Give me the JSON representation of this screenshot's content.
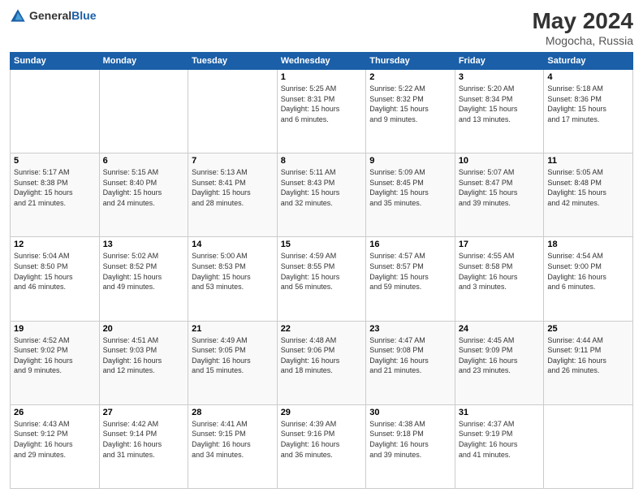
{
  "header": {
    "logo": {
      "general": "General",
      "blue": "Blue"
    },
    "title": "May 2024",
    "location": "Mogocha, Russia"
  },
  "days_of_week": [
    "Sunday",
    "Monday",
    "Tuesday",
    "Wednesday",
    "Thursday",
    "Friday",
    "Saturday"
  ],
  "weeks": [
    [
      {
        "day": "",
        "info": ""
      },
      {
        "day": "",
        "info": ""
      },
      {
        "day": "",
        "info": ""
      },
      {
        "day": "1",
        "info": "Sunrise: 5:25 AM\nSunset: 8:31 PM\nDaylight: 15 hours\nand 6 minutes."
      },
      {
        "day": "2",
        "info": "Sunrise: 5:22 AM\nSunset: 8:32 PM\nDaylight: 15 hours\nand 9 minutes."
      },
      {
        "day": "3",
        "info": "Sunrise: 5:20 AM\nSunset: 8:34 PM\nDaylight: 15 hours\nand 13 minutes."
      },
      {
        "day": "4",
        "info": "Sunrise: 5:18 AM\nSunset: 8:36 PM\nDaylight: 15 hours\nand 17 minutes."
      }
    ],
    [
      {
        "day": "5",
        "info": "Sunrise: 5:17 AM\nSunset: 8:38 PM\nDaylight: 15 hours\nand 21 minutes."
      },
      {
        "day": "6",
        "info": "Sunrise: 5:15 AM\nSunset: 8:40 PM\nDaylight: 15 hours\nand 24 minutes."
      },
      {
        "day": "7",
        "info": "Sunrise: 5:13 AM\nSunset: 8:41 PM\nDaylight: 15 hours\nand 28 minutes."
      },
      {
        "day": "8",
        "info": "Sunrise: 5:11 AM\nSunset: 8:43 PM\nDaylight: 15 hours\nand 32 minutes."
      },
      {
        "day": "9",
        "info": "Sunrise: 5:09 AM\nSunset: 8:45 PM\nDaylight: 15 hours\nand 35 minutes."
      },
      {
        "day": "10",
        "info": "Sunrise: 5:07 AM\nSunset: 8:47 PM\nDaylight: 15 hours\nand 39 minutes."
      },
      {
        "day": "11",
        "info": "Sunrise: 5:05 AM\nSunset: 8:48 PM\nDaylight: 15 hours\nand 42 minutes."
      }
    ],
    [
      {
        "day": "12",
        "info": "Sunrise: 5:04 AM\nSunset: 8:50 PM\nDaylight: 15 hours\nand 46 minutes."
      },
      {
        "day": "13",
        "info": "Sunrise: 5:02 AM\nSunset: 8:52 PM\nDaylight: 15 hours\nand 49 minutes."
      },
      {
        "day": "14",
        "info": "Sunrise: 5:00 AM\nSunset: 8:53 PM\nDaylight: 15 hours\nand 53 minutes."
      },
      {
        "day": "15",
        "info": "Sunrise: 4:59 AM\nSunset: 8:55 PM\nDaylight: 15 hours\nand 56 minutes."
      },
      {
        "day": "16",
        "info": "Sunrise: 4:57 AM\nSunset: 8:57 PM\nDaylight: 15 hours\nand 59 minutes."
      },
      {
        "day": "17",
        "info": "Sunrise: 4:55 AM\nSunset: 8:58 PM\nDaylight: 16 hours\nand 3 minutes."
      },
      {
        "day": "18",
        "info": "Sunrise: 4:54 AM\nSunset: 9:00 PM\nDaylight: 16 hours\nand 6 minutes."
      }
    ],
    [
      {
        "day": "19",
        "info": "Sunrise: 4:52 AM\nSunset: 9:02 PM\nDaylight: 16 hours\nand 9 minutes."
      },
      {
        "day": "20",
        "info": "Sunrise: 4:51 AM\nSunset: 9:03 PM\nDaylight: 16 hours\nand 12 minutes."
      },
      {
        "day": "21",
        "info": "Sunrise: 4:49 AM\nSunset: 9:05 PM\nDaylight: 16 hours\nand 15 minutes."
      },
      {
        "day": "22",
        "info": "Sunrise: 4:48 AM\nSunset: 9:06 PM\nDaylight: 16 hours\nand 18 minutes."
      },
      {
        "day": "23",
        "info": "Sunrise: 4:47 AM\nSunset: 9:08 PM\nDaylight: 16 hours\nand 21 minutes."
      },
      {
        "day": "24",
        "info": "Sunrise: 4:45 AM\nSunset: 9:09 PM\nDaylight: 16 hours\nand 23 minutes."
      },
      {
        "day": "25",
        "info": "Sunrise: 4:44 AM\nSunset: 9:11 PM\nDaylight: 16 hours\nand 26 minutes."
      }
    ],
    [
      {
        "day": "26",
        "info": "Sunrise: 4:43 AM\nSunset: 9:12 PM\nDaylight: 16 hours\nand 29 minutes."
      },
      {
        "day": "27",
        "info": "Sunrise: 4:42 AM\nSunset: 9:14 PM\nDaylight: 16 hours\nand 31 minutes."
      },
      {
        "day": "28",
        "info": "Sunrise: 4:41 AM\nSunset: 9:15 PM\nDaylight: 16 hours\nand 34 minutes."
      },
      {
        "day": "29",
        "info": "Sunrise: 4:39 AM\nSunset: 9:16 PM\nDaylight: 16 hours\nand 36 minutes."
      },
      {
        "day": "30",
        "info": "Sunrise: 4:38 AM\nSunset: 9:18 PM\nDaylight: 16 hours\nand 39 minutes."
      },
      {
        "day": "31",
        "info": "Sunrise: 4:37 AM\nSunset: 9:19 PM\nDaylight: 16 hours\nand 41 minutes."
      },
      {
        "day": "",
        "info": ""
      }
    ]
  ]
}
